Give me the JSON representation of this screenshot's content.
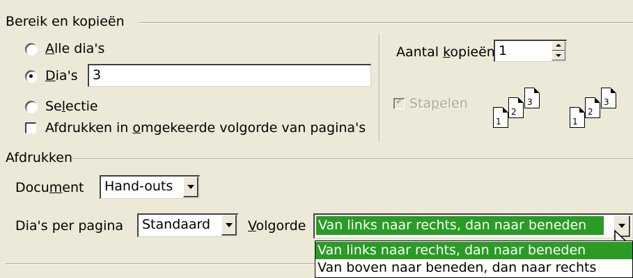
{
  "range": {
    "title": "Bereik en kopieën",
    "all_pre": "",
    "all_key": "A",
    "all_post": "lle dia's",
    "slides_pre": "",
    "slides_key": "D",
    "slides_post": "ia's",
    "slides_value": "3",
    "selection_pre": "Se",
    "selection_key": "l",
    "selection_post": "ectie",
    "reverse_pre": "Afdrukken in ",
    "reverse_key": "o",
    "reverse_post": "mgekeerde volgorde van pagina's",
    "selected": "slides"
  },
  "copies": {
    "label_pre": "Aantal ",
    "label_key": "k",
    "label_post": "opieën",
    "value": "1",
    "collate_pre": "Sta",
    "collate_key": "p",
    "collate_post": "elen",
    "page_numbers": [
      "1",
      "2",
      "3"
    ]
  },
  "print": {
    "title": "Afdrukken",
    "document_pre": "Docu",
    "document_key": "m",
    "document_post": "ent",
    "document_value": "Hand-outs",
    "per_page_pre": "Dia's per pa",
    "per_page_key": "g",
    "per_page_post": "ina",
    "per_page_value": "Standaard",
    "order_pre": "",
    "order_key": "V",
    "order_post": "olgorde",
    "order_value": "Van links naar rechts, dan naar beneden",
    "order_options": [
      "Van links naar rechts, dan naar beneden",
      "Van boven naar beneden, dan naar rechts"
    ]
  },
  "colors": {
    "selection": "#2a9b24",
    "face": "#ece9d8"
  }
}
